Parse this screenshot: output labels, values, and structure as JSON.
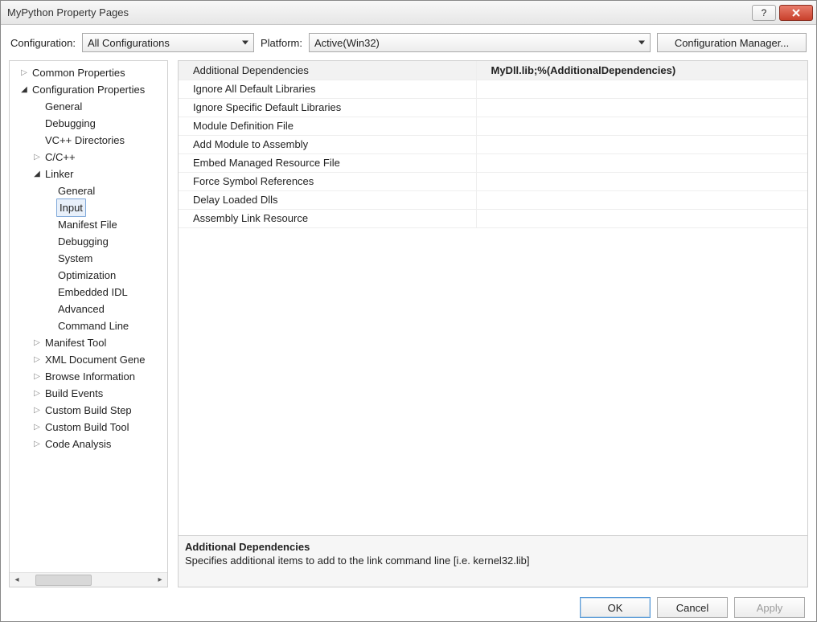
{
  "window": {
    "title": "MyPython Property Pages"
  },
  "configrow": {
    "config_label": "Configuration:",
    "config_value": "All Configurations",
    "platform_label": "Platform:",
    "platform_value": "Active(Win32)",
    "manager_button": "Configuration Manager..."
  },
  "tree": {
    "common": "Common Properties",
    "configprops": "Configuration Properties",
    "general": "General",
    "debugging": "Debugging",
    "vcpp_dirs": "VC++ Directories",
    "ccpp": "C/C++",
    "linker": "Linker",
    "linker_general": "General",
    "linker_input": "Input",
    "linker_manifest": "Manifest File",
    "linker_debugging": "Debugging",
    "linker_system": "System",
    "linker_optimization": "Optimization",
    "linker_embedded_idl": "Embedded IDL",
    "linker_advanced": "Advanced",
    "linker_cmdline": "Command Line",
    "manifest_tool": "Manifest Tool",
    "xml_doc_gen": "XML Document Gene",
    "browse_info": "Browse Information",
    "build_events": "Build Events",
    "custom_build_step": "Custom Build Step",
    "custom_build_tool": "Custom Build Tool",
    "code_analysis": "Code Analysis"
  },
  "grid": {
    "rows": [
      {
        "name": "Additional Dependencies",
        "value": "MyDll.lib;%(AdditionalDependencies)",
        "selected": true
      },
      {
        "name": "Ignore All Default Libraries",
        "value": ""
      },
      {
        "name": "Ignore Specific Default Libraries",
        "value": ""
      },
      {
        "name": "Module Definition File",
        "value": ""
      },
      {
        "name": "Add Module to Assembly",
        "value": ""
      },
      {
        "name": "Embed Managed Resource File",
        "value": ""
      },
      {
        "name": "Force Symbol References",
        "value": ""
      },
      {
        "name": "Delay Loaded Dlls",
        "value": ""
      },
      {
        "name": "Assembly Link Resource",
        "value": ""
      }
    ]
  },
  "desc": {
    "title": "Additional Dependencies",
    "text": "Specifies additional items to add to the link command line [i.e. kernel32.lib]"
  },
  "footer": {
    "ok": "OK",
    "cancel": "Cancel",
    "apply": "Apply"
  }
}
